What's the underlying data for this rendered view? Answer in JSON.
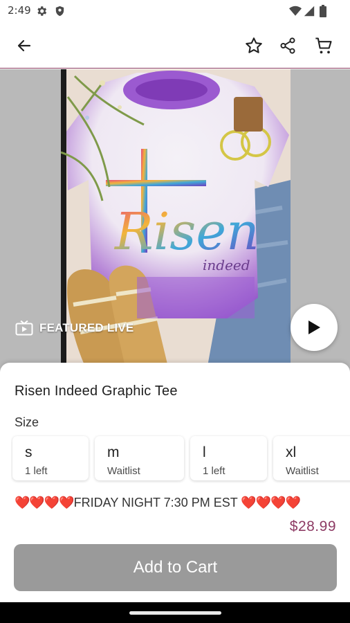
{
  "status_bar": {
    "time": "2:49",
    "icons": [
      "settings-gear-icon",
      "shield-icon",
      "wifi-icon",
      "signal-icon",
      "battery-icon"
    ]
  },
  "app_bar": {
    "icons": [
      "back-arrow-icon",
      "star-icon",
      "share-icon",
      "cart-icon"
    ]
  },
  "hero": {
    "featured_label": "FEATURED LIVE",
    "featured_icon": "live-tv-icon",
    "play_icon": "play-icon",
    "shirt_print": "Risen"
  },
  "product": {
    "title": "Risen Indeed Graphic Tee",
    "size_label": "Size",
    "sizes": [
      {
        "name": "s",
        "availability": "1 left"
      },
      {
        "name": "m",
        "availability": "Waitlist"
      },
      {
        "name": "l",
        "availability": "1 left"
      },
      {
        "name": "xl",
        "availability": "Waitlist"
      }
    ],
    "promo_hearts_left": "❤️❤️❤️❤️",
    "promo_text": "FRIDAY NIGHT 7:30 PM EST",
    "promo_hearts_right": "❤️❤️❤️❤️",
    "price": "$28.99",
    "add_to_cart_label": "Add to Cart"
  },
  "colors": {
    "accent": "#8d3b64",
    "button_disabled": "#9a9a9a",
    "app_bar_border": "#8a3a5f"
  }
}
